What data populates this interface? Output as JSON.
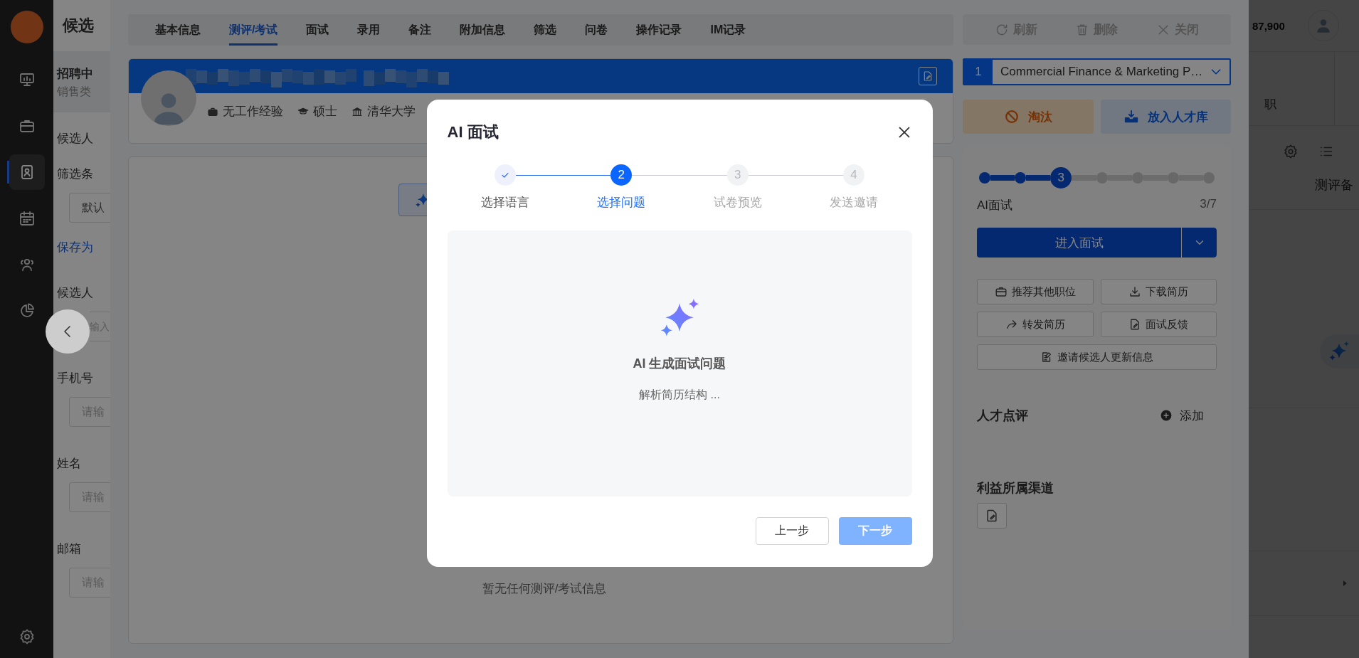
{
  "nav": {
    "items": [
      {
        "selected": false
      },
      {
        "selected": false
      },
      {
        "selected": true
      },
      {
        "selected": false
      },
      {
        "selected": false
      },
      {
        "selected": false
      }
    ]
  },
  "page": {
    "title": "候选",
    "status": "招聘中",
    "category": "销售类",
    "filters": [
      {
        "kind": "label",
        "text": "候选人"
      },
      {
        "kind": "label",
        "text": "筛选条"
      },
      {
        "kind": "field",
        "value": "默认"
      },
      {
        "kind": "link",
        "text": "保存为"
      },
      {
        "kind": "label",
        "text": "候选人"
      },
      {
        "kind": "partial_field",
        "placeholder": "输入"
      },
      {
        "kind": "label",
        "text": "手机号"
      },
      {
        "kind": "field",
        "placeholder": "请输"
      },
      {
        "kind": "label",
        "text": "姓名"
      },
      {
        "kind": "field",
        "placeholder": "请输"
      },
      {
        "kind": "label",
        "text": "邮箱"
      },
      {
        "kind": "field",
        "placeholder": "请输"
      }
    ],
    "header_number": "87,900",
    "column_1": "职",
    "column_2": "测评备"
  },
  "drawer": {
    "tabs": [
      {
        "label": "基本信息",
        "selected": false
      },
      {
        "label": "测评/考试",
        "selected": true
      },
      {
        "label": "面试",
        "selected": false
      },
      {
        "label": "录用",
        "selected": false
      },
      {
        "label": "备注",
        "selected": false
      },
      {
        "label": "附加信息",
        "selected": false
      },
      {
        "label": "筛选",
        "selected": false
      },
      {
        "label": "问卷",
        "selected": false
      },
      {
        "label": "操作记录",
        "selected": false
      },
      {
        "label": "IM记录",
        "selected": false
      }
    ],
    "candidate": {
      "facts": [
        "无工作经验",
        "硕士",
        "清华大学"
      ]
    },
    "empty_text": "暂无任何测评/考试信息",
    "toolbar": [
      "刷新",
      "删除",
      "关闭"
    ],
    "job": {
      "index": "1",
      "title": "Commercial Finance & Marketing P…"
    },
    "decisions": [
      {
        "label": "淘汰",
        "kind": "reject"
      },
      {
        "label": "放入人才库",
        "kind": "pool"
      }
    ],
    "pipeline": {
      "steps": [
        {
          "completed": true,
          "selected": false
        },
        {
          "completed": true,
          "selected": false
        },
        {
          "completed": true,
          "selected": true,
          "label": "3"
        },
        {
          "completed": false,
          "selected": false
        },
        {
          "completed": false,
          "selected": false
        },
        {
          "completed": false,
          "selected": false
        },
        {
          "completed": false,
          "selected": false
        }
      ],
      "stage": "AI面试",
      "count": "3/7"
    },
    "primary_action": "进入面试",
    "actions": [
      {
        "label": "推荐其他职位"
      },
      {
        "label": "下载简历"
      },
      {
        "label": "转发简历"
      },
      {
        "label": "面试反馈"
      },
      {
        "label": "邀请候选人更新信息"
      }
    ],
    "review": {
      "title": "人才点评",
      "action": "添加"
    },
    "channel": {
      "title": "利益所属渠道"
    }
  },
  "modal": {
    "title": "AI 面试",
    "steps": [
      {
        "label": "选择语言",
        "completed": true,
        "selected": false
      },
      {
        "label": "选择问题",
        "completed": false,
        "selected": true,
        "number": "2"
      },
      {
        "label": "试卷预览",
        "completed": false,
        "selected": false,
        "number": "3"
      },
      {
        "label": "发送邀请",
        "completed": false,
        "selected": false,
        "number": "4"
      }
    ],
    "heading": "AI 生成面试问题",
    "status_text": "解析简历结构 ...",
    "buttons": [
      {
        "label": "上一步",
        "kind": "secondary",
        "disabled": false
      },
      {
        "label": "下一步",
        "kind": "primary",
        "disabled": true
      }
    ]
  }
}
